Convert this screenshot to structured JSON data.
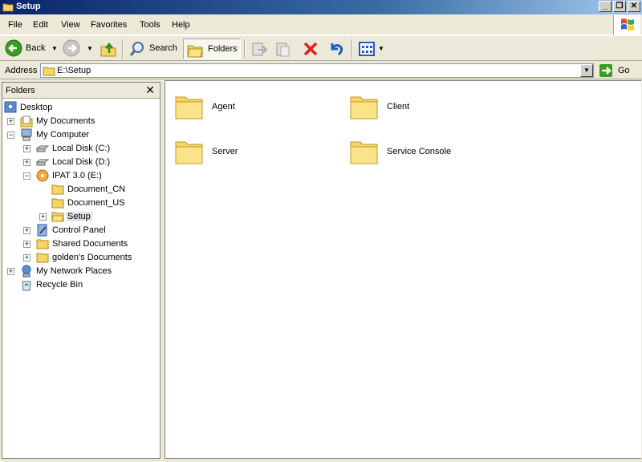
{
  "window": {
    "title": "Setup"
  },
  "menu": [
    "File",
    "Edit",
    "View",
    "Favorites",
    "Tools",
    "Help"
  ],
  "toolbar": {
    "back_label": "Back",
    "search_label": "Search",
    "folders_label": "Folders"
  },
  "address": {
    "label": "Address",
    "value": "E:\\Setup",
    "go_label": "Go"
  },
  "folders_pane": {
    "title": "Folders",
    "tree": [
      {
        "label": "Desktop"
      },
      {
        "label": "My Documents"
      },
      {
        "label": "My Computer"
      },
      {
        "label": "Local Disk (C:)"
      },
      {
        "label": "Local Disk (D:)"
      },
      {
        "label": "IPAT 3.0 (E:)"
      },
      {
        "label": "Document_CN"
      },
      {
        "label": "Document_US"
      },
      {
        "label": "Setup"
      },
      {
        "label": "Control Panel"
      },
      {
        "label": "Shared Documents"
      },
      {
        "label": "golden's Documents"
      },
      {
        "label": "My Network Places"
      },
      {
        "label": "Recycle Bin"
      }
    ]
  },
  "content": {
    "items": [
      {
        "label": "Agent"
      },
      {
        "label": "Client"
      },
      {
        "label": "Server"
      },
      {
        "label": "Service Console"
      }
    ]
  },
  "colors": {
    "titlebar": "#0a246a",
    "window_bg": "#ece9d8",
    "folder": "#f5d565"
  }
}
